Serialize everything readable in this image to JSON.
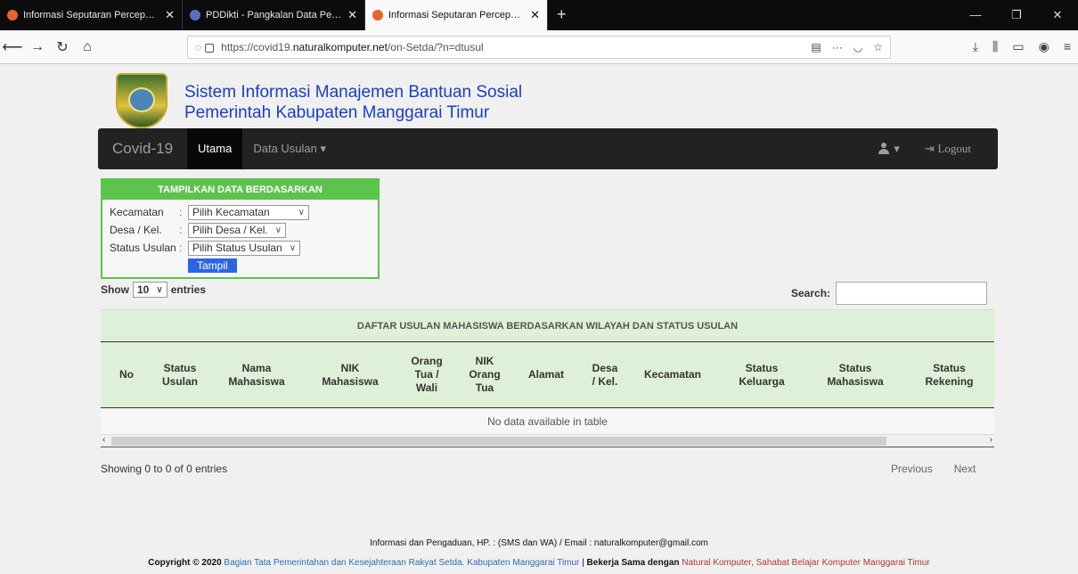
{
  "browser": {
    "tabs": [
      {
        "title": "Informasi Seputaran Percepatan",
        "favicon_color": "#e8632b"
      },
      {
        "title": "PDDikti - Pangkalan Data Pendidikan",
        "favicon_color": "#5b6cc4"
      },
      {
        "title": "Informasi Seputaran Percepatan",
        "favicon_color": "#e8632b",
        "active": true
      }
    ],
    "url_prefix": "https://covid19.",
    "url_domain": "naturalkomputer.net",
    "url_path": "/on-Setda/?n=dtusul"
  },
  "header": {
    "title_line1": "Sistem Informasi Manajemen Bantuan Sosial",
    "title_line2": "Pemerintah Kabupaten Manggarai Timur"
  },
  "nav": {
    "brand": "Covid-19",
    "utama": "Utama",
    "data_usulan": "Data Usulan",
    "logout": "Logout"
  },
  "filter": {
    "heading": "TAMPILKAN DATA BERDASARKAN",
    "kecamatan_label": "Kecamatan",
    "kecamatan_value": "Pilih Kecamatan",
    "desa_label": "Desa / Kel.",
    "desa_value": "Pilih Desa / Kel.",
    "status_label": "Status Usulan",
    "status_value": "Pilih Status Usulan",
    "button": "Tampil"
  },
  "table_controls": {
    "show": "Show",
    "entries_value": "10",
    "entries": "entries",
    "search": "Search:"
  },
  "table": {
    "caption": "DAFTAR USULAN MAHASISWA BERDASARKAN WILAYAH DAN STATUS USULAN",
    "columns": [
      "No",
      "Status\nUsulan",
      "Nama\nMahasiswa",
      "NIK\nMahasiswa",
      "Orang\nTua /\nWali",
      "NIK\nOrang\nTua",
      "Alamat",
      "Desa\n/ Kel.",
      "Kecamatan",
      "Status\nKeluarga",
      "Status\nMahasiswa",
      "Status\nRekening"
    ],
    "empty": "No data available in table"
  },
  "pagination": {
    "info": "Showing 0 to 0 of 0 entries",
    "previous": "Previous",
    "next": "Next"
  },
  "footer": {
    "contact": "Informasi dan Pengaduan, HP. : (SMS dan WA) / Email : naturalkomputer@gmail.com",
    "copyright_prefix": "Copyright © 2020 ",
    "org": "Bagian Tata Pemerintahan dan Kesejahteraan Rakyat Setda. Kabupaten Manggarai Timur",
    "sep": " | ",
    "bekerja": "Bekerja Sama dengan",
    "partner": "Natural Komputer, Sahabat Belajar Komputer Manggarai Timur"
  }
}
